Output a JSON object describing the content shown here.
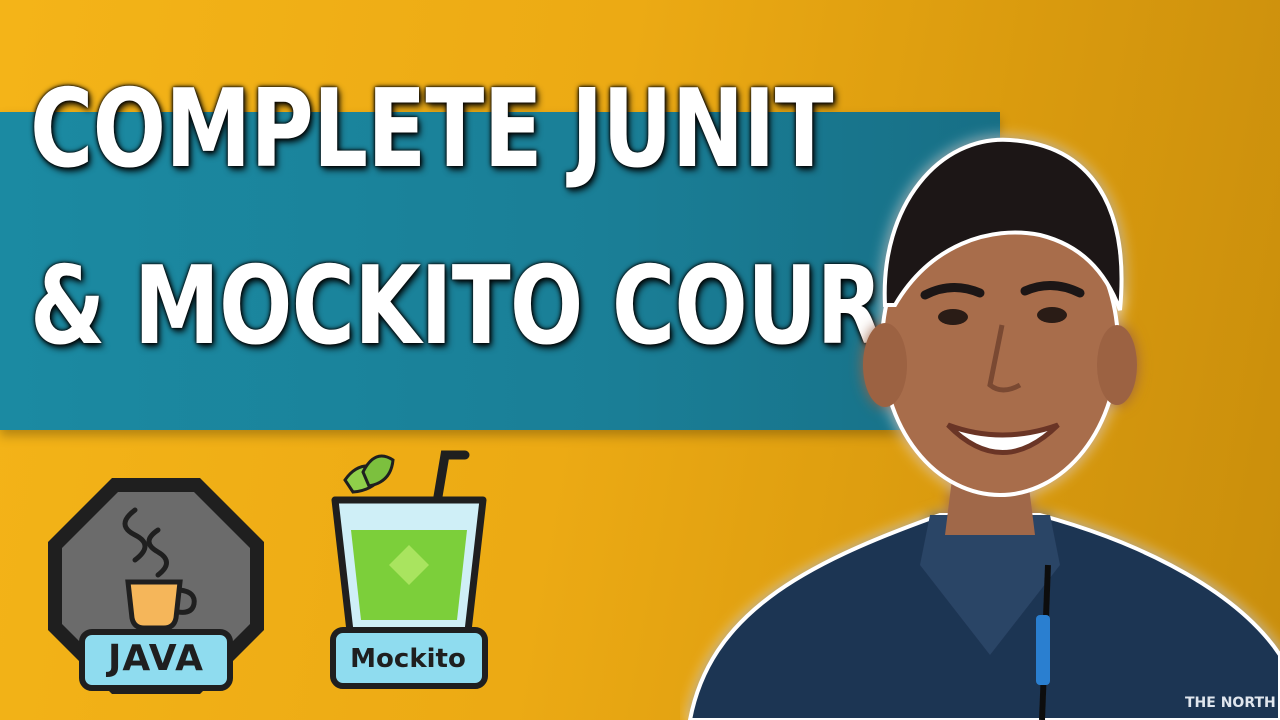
{
  "title": {
    "line1": "COMPLETE JUNIT",
    "line2": "& MOCKITO COURSE"
  },
  "logos": {
    "java": {
      "label": "JAVA",
      "icon": "java-coffee-cup-icon"
    },
    "mockito": {
      "label": "Mockito",
      "icon": "mojito-glass-icon"
    }
  },
  "jacket_logo_text": "THE NORTH FACE",
  "colors": {
    "background": "#f4b418",
    "band": "#1b8aa2",
    "title_text": "#ffffff",
    "title_outline": "#000000",
    "jacket": "#1f3552"
  }
}
